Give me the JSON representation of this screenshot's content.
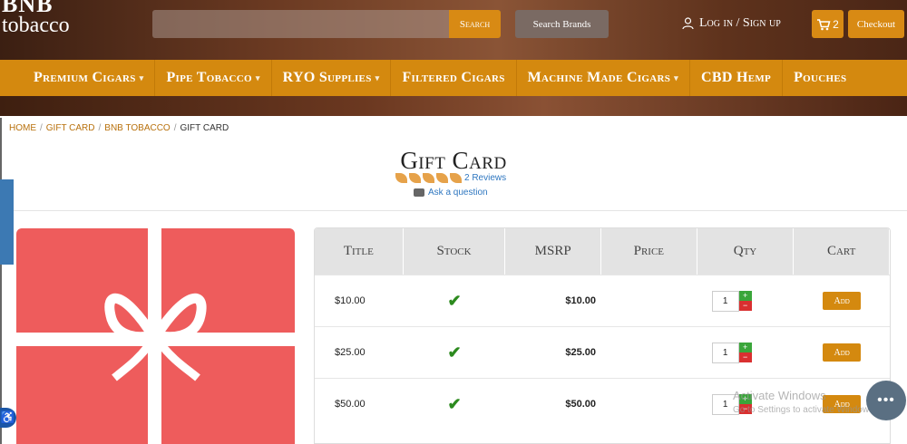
{
  "header": {
    "logo_top": "BNB",
    "logo_bottom": "tobacco",
    "search_button": "Search",
    "search_brands_button": "Search Brands",
    "login_label": "Log in / Sign up",
    "cart_count": "2",
    "checkout_button": "Checkout"
  },
  "nav": {
    "items": [
      {
        "label": "Premium Cigars",
        "has_caret": true
      },
      {
        "label": "Pipe Tobacco",
        "has_caret": true
      },
      {
        "label": "RYO Supplies",
        "has_caret": true
      },
      {
        "label": "Filtered Cigars",
        "has_caret": false
      },
      {
        "label": "Machine Made Cigars",
        "has_caret": true
      },
      {
        "label": "CBD Hemp",
        "has_caret": false
      },
      {
        "label": "Pouches",
        "has_caret": false
      }
    ]
  },
  "breadcrumb": {
    "home": "HOME",
    "gift_card": "GIFT CARD",
    "brand": "BNB TOBACCO",
    "current": "GIFT CARD"
  },
  "product": {
    "title": "Gift Card",
    "rating": 5,
    "reviews_label": "2 Reviews",
    "ask_label": "Ask a question"
  },
  "table": {
    "headers": [
      "Title",
      "Stock",
      "MSRP",
      "Price",
      "Qty",
      "Cart"
    ],
    "rows": [
      {
        "title": "$10.00",
        "in_stock": true,
        "msrp": "$10.00",
        "price": "",
        "qty": "1",
        "add_label": "Add"
      },
      {
        "title": "$25.00",
        "in_stock": true,
        "msrp": "$25.00",
        "price": "",
        "qty": "1",
        "add_label": "Add"
      },
      {
        "title": "$50.00",
        "in_stock": true,
        "msrp": "$50.00",
        "price": "",
        "qty": "1",
        "add_label": "Add"
      }
    ]
  },
  "overlay": {
    "activate_title": "Activate Windows",
    "activate_sub": "Go to Settings to activate Windows."
  },
  "colors": {
    "accent": "#d4890f",
    "gift_red": "#ee5c5c",
    "link": "#2f77c0",
    "stock_check": "#2c8a1e"
  }
}
